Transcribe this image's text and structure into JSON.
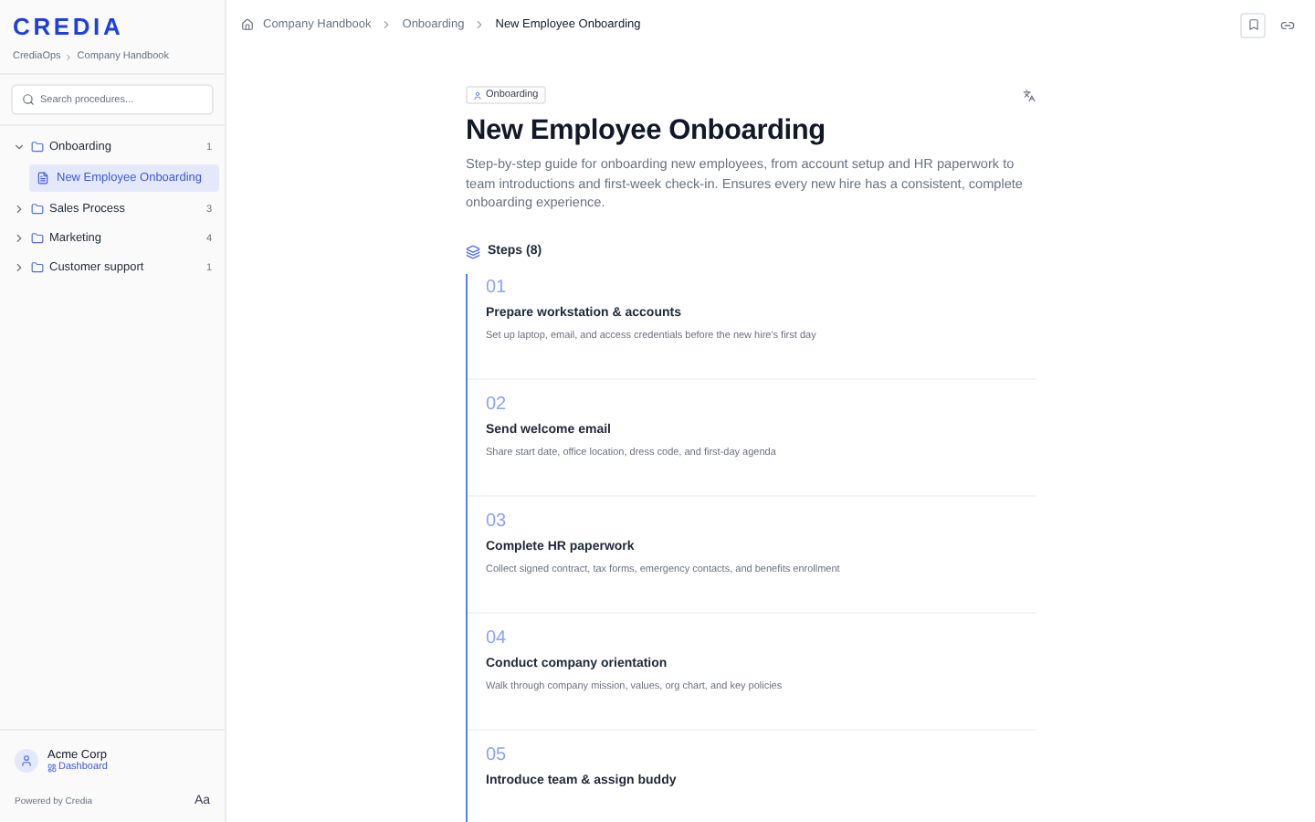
{
  "sidebar": {
    "logo": "CREDIA",
    "breadcrumb": [
      "CrediaOps",
      "Company Handbook"
    ],
    "search": {
      "placeholder": "Search procedures..."
    },
    "folders": [
      {
        "label": "Onboarding",
        "count": "1",
        "expanded": true,
        "children": [
          {
            "label": "New Employee Onboarding",
            "selected": true
          }
        ]
      },
      {
        "label": "Sales Process",
        "count": "3",
        "expanded": false
      },
      {
        "label": "Marketing",
        "count": "4",
        "expanded": false
      },
      {
        "label": "Customer support",
        "count": "1",
        "expanded": false
      }
    ],
    "account": {
      "name": "Acme Corp",
      "link": "Dashboard"
    },
    "powered_by": "Powered by Credia",
    "font_button": "Aa"
  },
  "breadcrumb": [
    "Company Handbook",
    "Onboarding",
    "New Employee Onboarding"
  ],
  "document": {
    "tag": "Onboarding",
    "title": "New Employee Onboarding",
    "description": "Step-by-step guide for onboarding new employees, from account setup and HR paperwork to team introductions and first-week check-in. Ensures every new hire has a consistent, complete onboarding experience.",
    "steps_heading": "Steps (8)",
    "steps": [
      {
        "number": "01",
        "title": "Prepare workstation & accounts",
        "description": "Set up laptop, email, and access credentials before the new hire's first day"
      },
      {
        "number": "02",
        "title": "Send welcome email",
        "description": "Share start date, office location, dress code, and first-day agenda"
      },
      {
        "number": "03",
        "title": "Complete HR paperwork",
        "description": "Collect signed contract, tax forms, emergency contacts, and benefits enrollment"
      },
      {
        "number": "04",
        "title": "Conduct company orientation",
        "description": "Walk through company mission, values, org chart, and key policies"
      },
      {
        "number": "05",
        "title": "Introduce team & assign buddy"
      }
    ]
  }
}
